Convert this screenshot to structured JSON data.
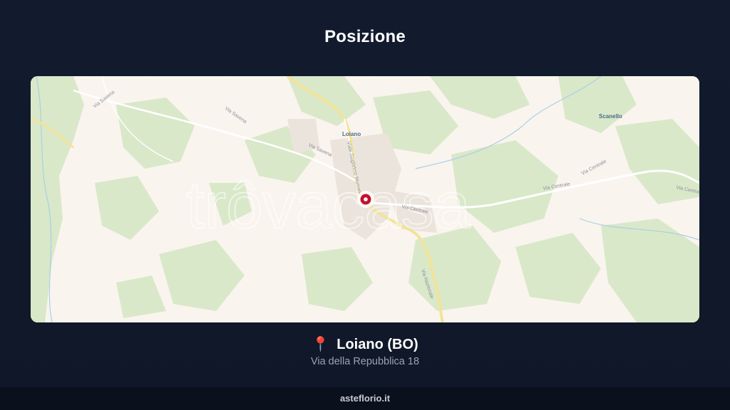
{
  "header": {
    "title": "Posizione"
  },
  "map": {
    "watermark": "trôvacasa",
    "places": {
      "loiano": "Loiano",
      "scanello": "Scanello"
    },
    "streets": {
      "via_savena_1": "Via Savena",
      "via_savena_2": "Via Savena",
      "via_savena_3": "Via Savena",
      "viale_marconi": "Viale Guglielmo Marconi",
      "via_centrale_1": "Via Centrale",
      "via_centrale_2": "Via Centrale",
      "via_centrale_3": "Via Centrale",
      "via_centrale_4": "Via Centrale",
      "via_nazionale": "Via Nazionale"
    }
  },
  "location": {
    "pin_icon": "📍",
    "city": "Loiano (BO)",
    "address": "Via della Repubblica 18"
  },
  "footer": {
    "site": "asteflorio.it"
  }
}
